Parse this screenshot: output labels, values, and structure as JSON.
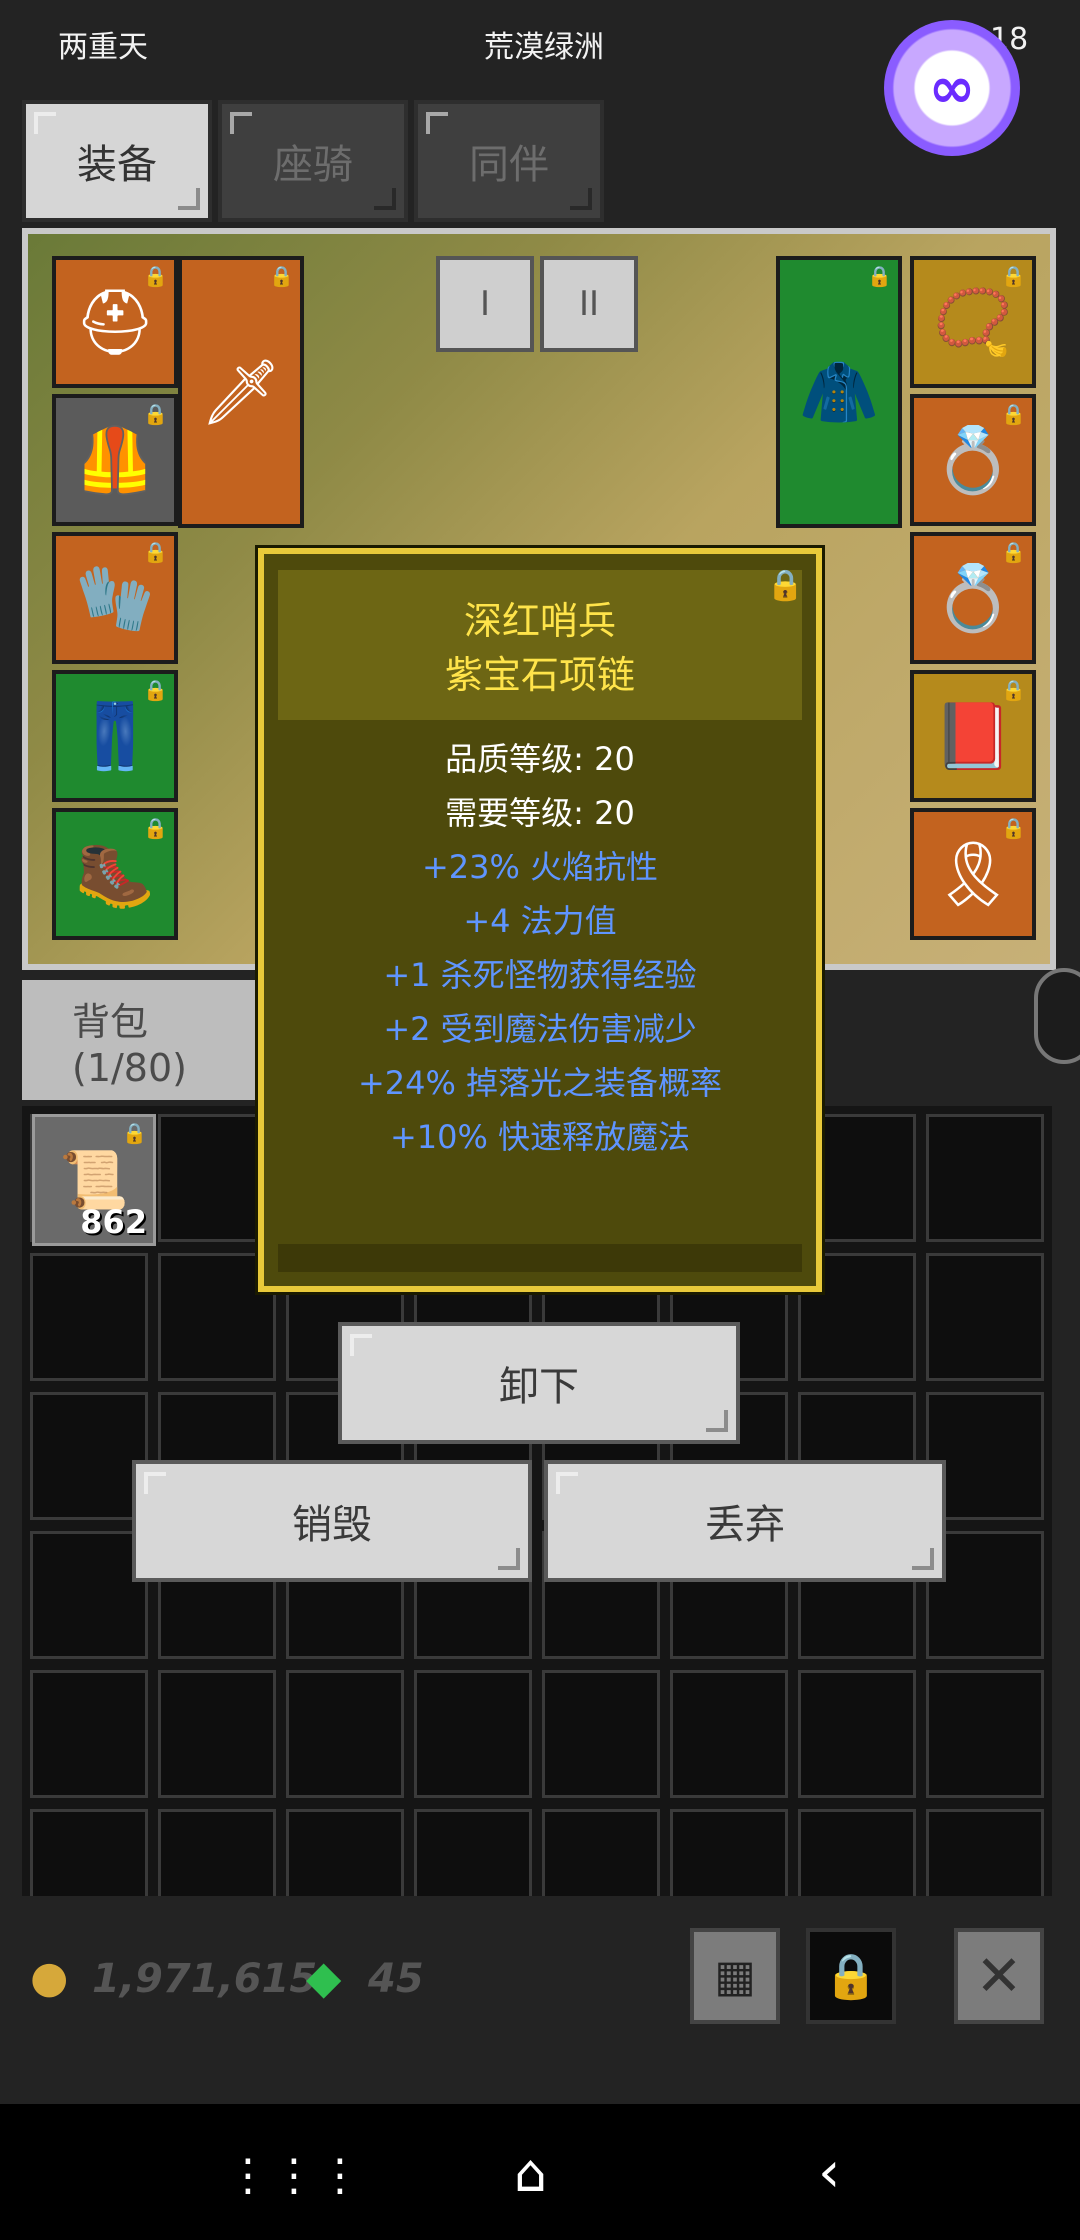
{
  "status": {
    "left": "两重天",
    "center": "荒漠绿洲",
    "right_clock": "18"
  },
  "tabs": [
    {
      "label": "装备"
    },
    {
      "label": "座骑"
    },
    {
      "label": "同伴"
    }
  ],
  "scene_buttons": {
    "one": "I",
    "two": "II"
  },
  "bag": {
    "label": "背包 (1/80)"
  },
  "bag_item": {
    "count": "862"
  },
  "tooltip": {
    "name_line1": "深红哨兵",
    "name_line2": "紫宝石项链",
    "quality": "品质等级: 20",
    "require": "需要等级: 20",
    "attrs": [
      "+23% 火焰抗性",
      "+4 法力值",
      "+1 杀死怪物获得经验",
      "+2 受到魔法伤害减少",
      "+24% 掉落光之装备概率",
      "+10% 快速释放魔法"
    ]
  },
  "actions": {
    "unequip": "卸下",
    "destroy": "销毁",
    "drop": "丢弃"
  },
  "currency": {
    "gold": "1,971,615",
    "gems": "45"
  },
  "colors": {
    "accent": "#e8c93a",
    "attr_blue": "#5f95ff",
    "name_yellow": "#ffe44a"
  },
  "icons": [
    "lock-icon",
    "grid-icon",
    "close-icon",
    "home-icon",
    "back-icon",
    "menu-icon",
    "gold-icon",
    "gem-icon"
  ]
}
